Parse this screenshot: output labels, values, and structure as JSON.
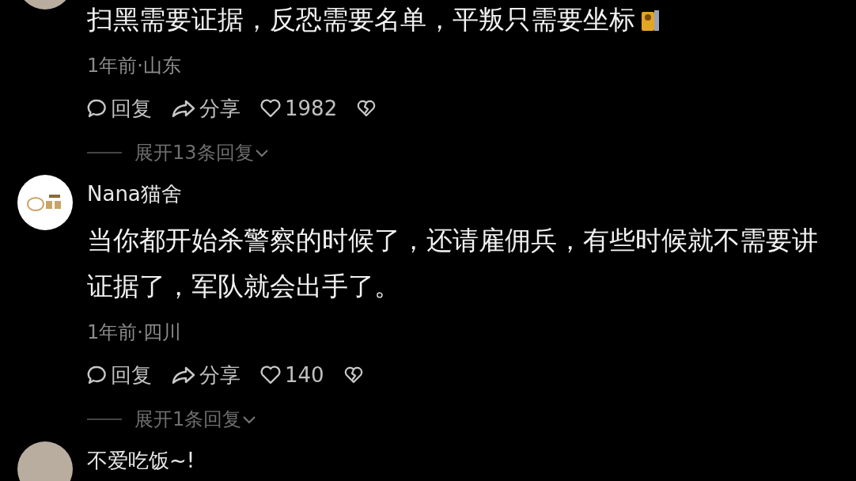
{
  "comments": [
    {
      "avatar": {
        "kind": "photo"
      },
      "text": "扫黑需要证据，反恐需要名单，平叛只需要坐标",
      "sticker": true,
      "meta": "1年前·山东",
      "reply": "回复",
      "share": "分享",
      "likes": "1982",
      "expand": "展开13条回复"
    },
    {
      "avatar": {
        "kind": "logo"
      },
      "name": "Nana猫舍",
      "text": "当你都开始杀警察的时候了，还请雇佣兵，有些时候就不需要讲证据了，军队就会出手了。",
      "sticker": false,
      "meta": "1年前·四川",
      "reply": "回复",
      "share": "分享",
      "likes": "140",
      "expand": "展开1条回复"
    },
    {
      "avatar": {
        "kind": "photo"
      },
      "name": "不爱吃饭~!"
    }
  ]
}
